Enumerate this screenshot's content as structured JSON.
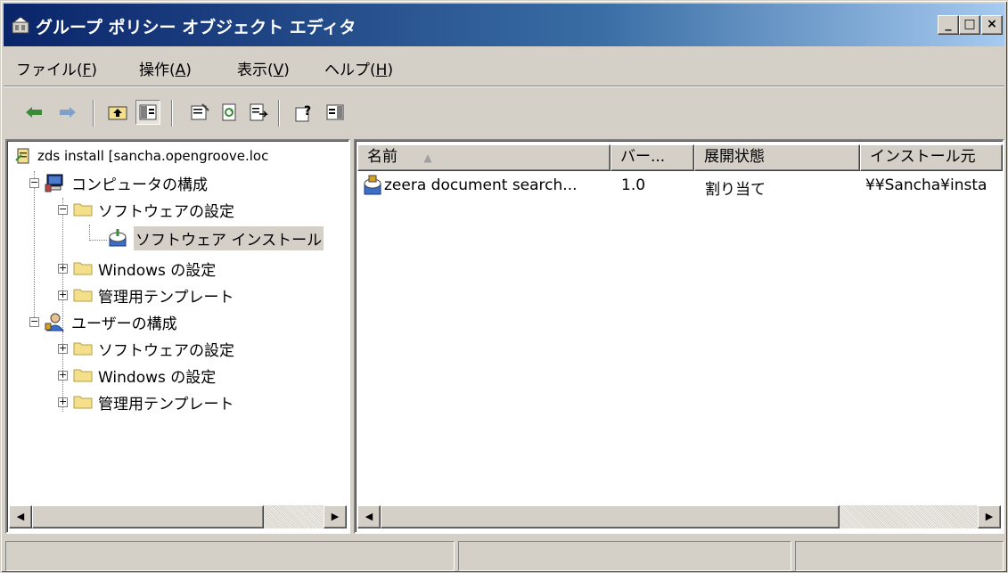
{
  "window": {
    "title": "グループ ポリシー オブジェクト エディタ"
  },
  "title_buttons": {
    "minimize": "_",
    "maximize": "□",
    "close": "×"
  },
  "menu": [
    {
      "label": "ファイル(",
      "key": "F",
      "end": ")"
    },
    {
      "label": "操作(",
      "key": "A",
      "end": ")"
    },
    {
      "label": "表示(",
      "key": "V",
      "end": ")"
    },
    {
      "label": "ヘルプ(",
      "key": "H",
      "end": ")"
    }
  ],
  "toolbar": {
    "buttons": [
      "back-icon",
      "forward-icon",
      "up-folder-icon",
      "show-hide-tree-icon",
      "properties-icon",
      "refresh-icon",
      "export-list-icon",
      "help-icon",
      "show-action-pane-icon"
    ]
  },
  "tree": {
    "root": "zds install [sancha.opengroove.loc",
    "computer_config": "コンピュータの構成",
    "software_settings": "ソフトウェアの設定",
    "software_install": "ソフトウェア インストール",
    "windows_settings": "Windows の設定",
    "admin_templates": "管理用テンプレート",
    "user_config": "ユーザーの構成",
    "user_software_settings": "ソフトウェアの設定",
    "user_windows_settings": "Windows の設定",
    "user_admin_templates": "管理用テンプレート"
  },
  "list": {
    "columns": [
      "名前",
      "バー...",
      "展開状態",
      "インストール元"
    ],
    "rows": [
      {
        "name": "zeera document search...",
        "version": "1.0",
        "deployment": "割り当て",
        "source": "¥¥Sancha¥insta"
      }
    ]
  },
  "colors": {
    "title_gradient_start": "#0a246a",
    "title_gradient_end": "#a6caf0",
    "chrome": "#d4d0c8",
    "folder": "#f4e08a"
  }
}
